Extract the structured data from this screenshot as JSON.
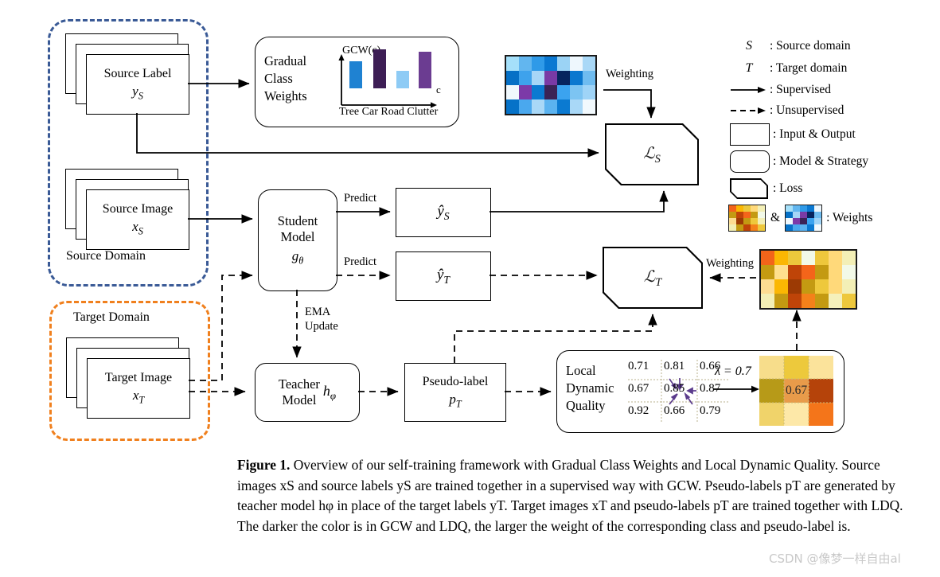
{
  "figure": {
    "caption_label": "Figure 1.",
    "caption_text": " Overview of our self-training framework with Gradual Class Weights and Local Dynamic Quality. Source images xS and source labels yS are trained together in a supervised way with GCW. Pseudo-labels pT are generated by teacher model hφ in place of the target labels yT. Target images xT and pseudo-labels pT are trained together with LDQ. The darker the color is in GCW and LDQ, the larger the weight of the corresponding class and pseudo-label is.",
    "caption_lines": [
      "Overview of our self-training framework with Gradual Class",
      "Quality. Source images xS and source labels yS are trained together in a supervised way with GCW.",
      "Pseudo-labels pT are generated by teacher model hφ in place of the target labels yT. Target images xT",
      "and pseudo-labels pT are trained together with LDQ. The darker the color is in GCW and LDQ, the",
      "larger the weight of the corresponding class and pseudo-label is."
    ]
  },
  "watermark": "CSDN @像梦一样自由al",
  "source_domain": {
    "label": "Source Domain",
    "source_label_box": {
      "line1": "Source Label",
      "line2": "y",
      "sub": "S"
    },
    "source_image_box": {
      "line1": "Source Image",
      "line2": "x",
      "sub": "S"
    }
  },
  "target_domain": {
    "label": "Target Domain",
    "target_image_box": {
      "line1": "Target Image",
      "line2": "x",
      "sub": "T"
    }
  },
  "gcw": {
    "title_lines": [
      "Gradual",
      "Class",
      "Weights"
    ],
    "chart": {
      "ylabel": "GCW(c)",
      "xlabel": "c",
      "categories": [
        "Tree",
        "Car",
        "Road",
        "Clutter"
      ],
      "tick_text": "Tree Car Road Clutter"
    }
  },
  "student_model": {
    "line1": "Student",
    "line2": "Model",
    "line3": "g",
    "sub": "θ"
  },
  "teacher_model": {
    "line1": "Teacher",
    "line2": "Model",
    "symbol": "h",
    "sub": "φ"
  },
  "pseudo_label": {
    "line1": "Pseudo-label",
    "line2": "p",
    "sub": "T"
  },
  "pred_source": {
    "symbol": "ŷ",
    "sub": "S"
  },
  "pred_target": {
    "symbol": "ŷ",
    "sub": "T"
  },
  "loss_source": {
    "symbol": "ℒ",
    "sub": "S"
  },
  "loss_target": {
    "symbol": "ℒ",
    "sub": "T"
  },
  "edge_labels": {
    "predict_top": "Predict",
    "predict_bottom": "Predict",
    "ema_line1": "EMA",
    "ema_line2": "Update",
    "weighting_top": "Weighting",
    "weighting_bottom": "Weighting"
  },
  "ldq": {
    "title_lines": [
      "Local",
      "Dynamic",
      "Quality"
    ],
    "lambda_label": "λ = 0.7",
    "center_value": "0.67",
    "grid": [
      [
        "0.71",
        "0.81",
        "0.66"
      ],
      [
        "0.67",
        "0.85",
        "0.87"
      ],
      [
        "0.92",
        "0.66",
        "0.79"
      ]
    ]
  },
  "legend": {
    "items": [
      {
        "key": "S",
        "text": ": Source domain",
        "icon": "symbol-s"
      },
      {
        "key": "T",
        "text": ": Target domain",
        "icon": "symbol-t"
      },
      {
        "key": "",
        "text": ": Supervised",
        "icon": "solid-arrow-icon"
      },
      {
        "key": "",
        "text": ": Unsupervised",
        "icon": "dashed-arrow-icon"
      },
      {
        "key": "",
        "text": ": Input & Output",
        "icon": "rect-icon"
      },
      {
        "key": "",
        "text": ": Model & Strategy",
        "icon": "rounded-rect-icon"
      },
      {
        "key": "",
        "text": ": Loss",
        "icon": "loss-shape-icon"
      },
      {
        "key": "",
        "text": ": Weights",
        "icon": "heatmap-swatch-icon",
        "amp": "&"
      }
    ]
  },
  "colors": {
    "source_dash": "#3a5a96",
    "target_dash": "#f0801e",
    "bar_tree": "#1f82d2",
    "bar_car": "#3d1e55",
    "bar_road": "#8ecbf5",
    "bar_clutter": "#6b3c91",
    "arrow_purple": "#5b3b8c"
  },
  "heatmap_blue": [
    [
      "#a5e0fa",
      "#62b6ef",
      "#2f9ae8",
      "#0a78d2",
      "#9bd3f5",
      "#eef7fd",
      "#a9d8f7"
    ],
    [
      "#0670c6",
      "#3ea2ec",
      "#a7d6f7",
      "#7a3aa5",
      "#07245e",
      "#0b78cf",
      "#6fbcf0"
    ],
    [
      "#f0f8fd",
      "#7c3aa8",
      "#0b7ad1",
      "#3b2356",
      "#3ba3ef",
      "#7cc4f2",
      "#9fd4f7"
    ],
    [
      "#0672c8",
      "#4aa8ee",
      "#a9d8f7",
      "#5bb3f0",
      "#0b7ad1",
      "#a9d8f7",
      "#f2f9fd"
    ]
  ],
  "heatmap_orange": [
    [
      "#f3641a",
      "#fbb703",
      "#ecc83c",
      "#f2f9e8",
      "#eec73c",
      "#ffd97a",
      "#f3efb6"
    ],
    [
      "#c49a12",
      "#ffdf8d",
      "#bf4408",
      "#f4651a",
      "#c49a12",
      "#ffd97a",
      "#f2f9e8"
    ],
    [
      "#fddc92",
      "#fbb703",
      "#9c3a04",
      "#c49a12",
      "#eec83c",
      "#ffd97a",
      "#f3efb6"
    ],
    [
      "#f3efb6",
      "#c49a12",
      "#bf4408",
      "#f4811a",
      "#c49a12",
      "#f5f0bb",
      "#eec83c"
    ]
  ],
  "ldq_result_colors": [
    [
      "#f7dd8b",
      "#edc93c",
      "#fbe39b"
    ],
    [
      "#b79a18",
      "#e89b4a",
      "#b5430a"
    ],
    [
      "#f0d36a",
      "#fde8a8",
      "#f4751a"
    ]
  ]
}
